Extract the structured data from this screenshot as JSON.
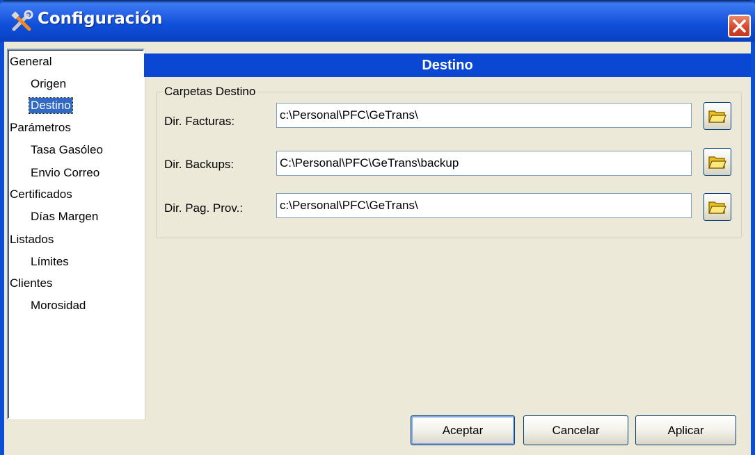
{
  "window": {
    "title": "Configuración"
  },
  "tree": {
    "items": [
      {
        "label": "General",
        "level": 0
      },
      {
        "label": "Origen",
        "level": 1
      },
      {
        "label": "Destino",
        "level": 1,
        "selected": true
      },
      {
        "label": "Parámetros",
        "level": 0
      },
      {
        "label": "Tasa Gasóleo",
        "level": 1
      },
      {
        "label": "Envio Correo",
        "level": 1
      },
      {
        "label": "Certificados",
        "level": 0
      },
      {
        "label": "Días Margen",
        "level": 1
      },
      {
        "label": "Listados",
        "level": 0
      },
      {
        "label": "Límites",
        "level": 1
      },
      {
        "label": "Clientes",
        "level": 0
      },
      {
        "label": "Morosidad",
        "level": 1
      }
    ]
  },
  "panel": {
    "header": "Destino",
    "group_title": "Carpetas Destino",
    "fields": [
      {
        "label": "Dir. Facturas:",
        "value": "c:\\Personal\\PFC\\GeTrans\\"
      },
      {
        "label": "Dir. Backups:",
        "value": "C:\\Personal\\PFC\\GeTrans\\backup"
      },
      {
        "label": "Dir. Pag. Prov.:",
        "value": "c:\\Personal\\PFC\\GeTrans\\"
      }
    ]
  },
  "buttons": {
    "accept": "Aceptar",
    "cancel": "Cancelar",
    "apply": "Aplicar"
  },
  "colors": {
    "header_bg": "#0a48d4",
    "selection_bg": "#316ac5",
    "dialog_bg": "#ece9d8"
  }
}
